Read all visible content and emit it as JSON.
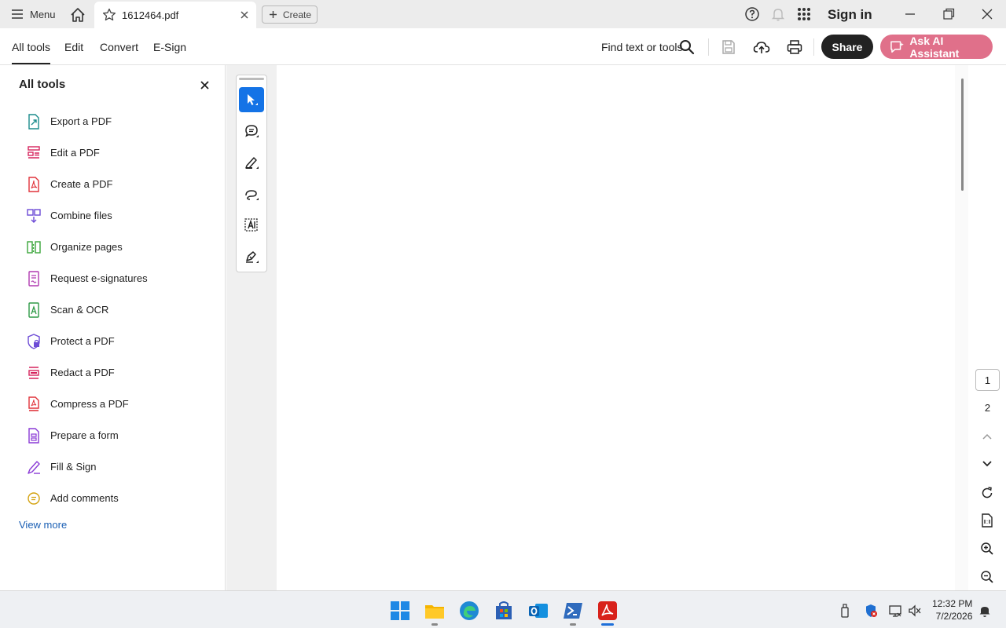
{
  "titlebar": {
    "menu_label": "Menu",
    "tab_title": "1612464.pdf",
    "create_label": "Create",
    "signin_label": "Sign in"
  },
  "toolbar": {
    "nav": [
      "All tools",
      "Edit",
      "Convert",
      "E-Sign"
    ],
    "active_nav": "All tools",
    "find_label": "Find text or tools",
    "share_label": "Share",
    "ai_label": "Ask AI Assistant"
  },
  "panel": {
    "title": "All tools",
    "tools": [
      {
        "label": "Export a PDF",
        "icon": "export-pdf-icon",
        "color": "#1b8c8c"
      },
      {
        "label": "Edit a PDF",
        "icon": "edit-pdf-icon",
        "color": "#d6245d"
      },
      {
        "label": "Create a PDF",
        "icon": "create-pdf-icon",
        "color": "#e0343b"
      },
      {
        "label": "Combine files",
        "icon": "combine-files-icon",
        "color": "#6d4bd6"
      },
      {
        "label": "Organize pages",
        "icon": "organize-pages-icon",
        "color": "#3aa63a"
      },
      {
        "label": "Request e-signatures",
        "icon": "request-esignatures-icon",
        "color": "#b03ab0"
      },
      {
        "label": "Scan & OCR",
        "icon": "scan-ocr-icon",
        "color": "#2e9a46"
      },
      {
        "label": "Protect a PDF",
        "icon": "protect-pdf-icon",
        "color": "#6d4bd6"
      },
      {
        "label": "Redact a PDF",
        "icon": "redact-pdf-icon",
        "color": "#d6245d"
      },
      {
        "label": "Compress a PDF",
        "icon": "compress-pdf-icon",
        "color": "#e0343b"
      },
      {
        "label": "Prepare a form",
        "icon": "prepare-form-icon",
        "color": "#8a3ad6"
      },
      {
        "label": "Fill & Sign",
        "icon": "fill-sign-icon",
        "color": "#8a3ad6"
      },
      {
        "label": "Add comments",
        "icon": "add-comments-icon",
        "color": "#d4a20f"
      }
    ],
    "view_more": "View more"
  },
  "rail": {
    "pages": [
      "1",
      "2"
    ],
    "current_page": "1"
  },
  "taskbar": {
    "time": "12:32 PM",
    "date": "7/2/2026"
  },
  "colors": {
    "accent": "#1473e6",
    "ai_button": "#e0708a",
    "share_button": "#222222"
  }
}
